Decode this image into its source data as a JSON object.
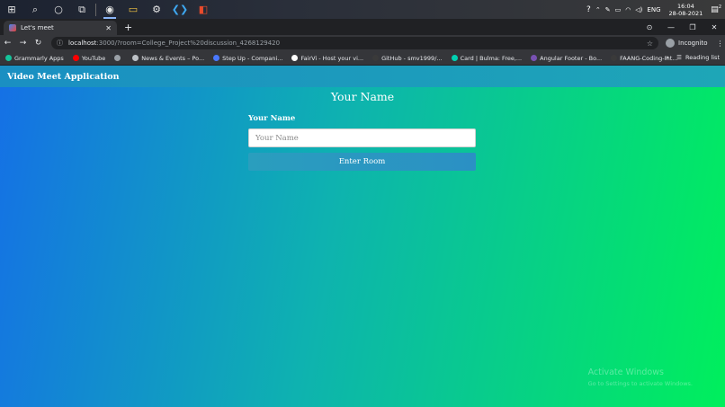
{
  "taskbar": {
    "icons": [
      {
        "name": "windows-start-icon",
        "glyph": "⊞"
      },
      {
        "name": "search-icon",
        "glyph": "⌕"
      },
      {
        "name": "cortana-icon",
        "glyph": "○"
      },
      {
        "name": "task-view-icon",
        "glyph": "⧉"
      },
      {
        "name": "chrome-icon",
        "glyph": "◉"
      },
      {
        "name": "file-explorer-icon",
        "glyph": "▭"
      },
      {
        "name": "settings-icon",
        "glyph": "⚙"
      },
      {
        "name": "vscode-icon",
        "glyph": "❮❯"
      },
      {
        "name": "office-icon",
        "glyph": "◧"
      }
    ],
    "language": "ENG",
    "time": "16:04",
    "date": "28-08-2021",
    "notification_count": "2"
  },
  "browser": {
    "tab_title": "Let's meet",
    "url_host": "localhost",
    "url_path": ":3000/?room=College_Project%20discussion_4268129420",
    "profile": "Incognito",
    "bookmarks": [
      {
        "label": "Grammarly Apps",
        "color": "#15c39a"
      },
      {
        "label": "YouTube",
        "color": "#ff0000"
      },
      {
        "label": "",
        "color": "#9aa0a6"
      },
      {
        "label": "News & Events – Po...",
        "color": "#bdc1c6"
      },
      {
        "label": "Step Up - Compani...",
        "color": "#4a78ff"
      },
      {
        "label": "FairVi - Host your vi...",
        "color": "#ffffff"
      },
      {
        "label": "GitHub - smv1999/...",
        "color": "#3a3a3a"
      },
      {
        "label": "Card | Bulma: Free,...",
        "color": "#00d1b2"
      },
      {
        "label": "Angular Footer - Bo...",
        "color": "#7952b3"
      },
      {
        "label": "FAANG-Coding-Int...",
        "color": "#3a3a3a"
      }
    ],
    "reading_list": "Reading list"
  },
  "app": {
    "header_title": "Video Meet Application",
    "page_title": "Your Name",
    "form_label": "Your Name",
    "input_placeholder": "Your Name",
    "input_value": "",
    "button_label": "Enter Room"
  },
  "watermark": {
    "title": "Activate Windows",
    "subtitle": "Go to Settings to activate Windows."
  }
}
